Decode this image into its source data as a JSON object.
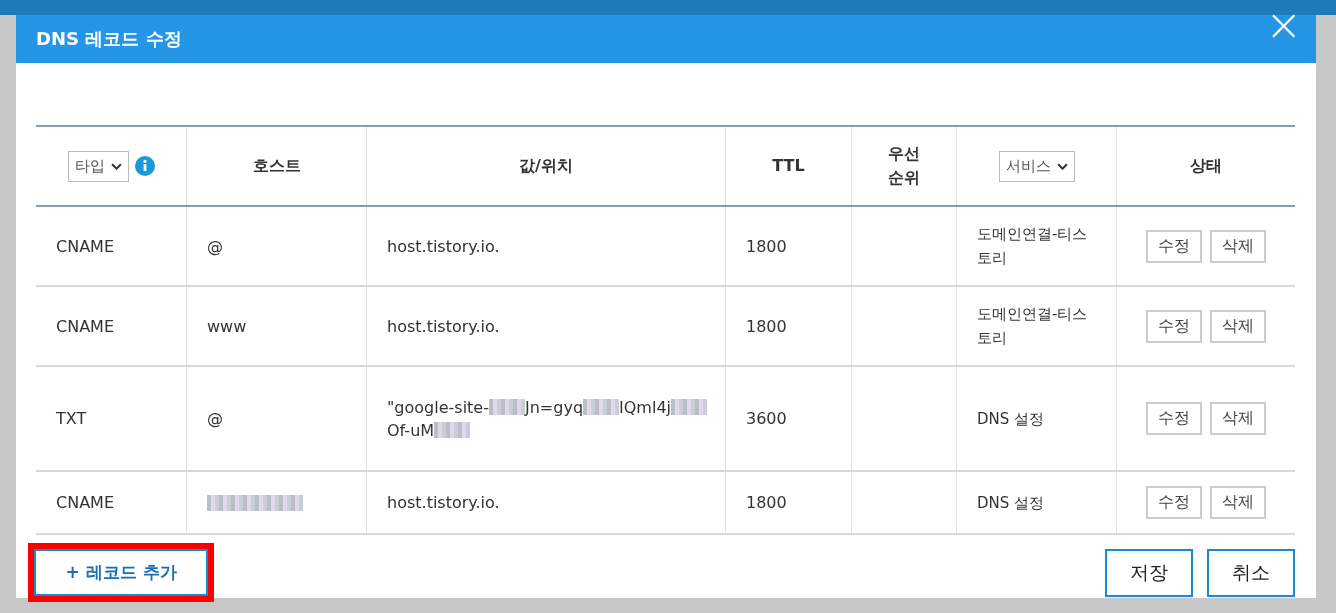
{
  "dialog": {
    "title": "DNS 레코드 수정",
    "close": "×"
  },
  "table": {
    "columns": [
      {
        "kind": "select",
        "label": "타입",
        "info": true
      },
      {
        "kind": "text",
        "label": "호스트"
      },
      {
        "kind": "text",
        "label": "값/위치"
      },
      {
        "kind": "text",
        "label": "TTL"
      },
      {
        "kind": "text",
        "label": "우선\n순위"
      },
      {
        "kind": "select",
        "label": "서비스",
        "info": false
      },
      {
        "kind": "text",
        "label": "상태"
      }
    ],
    "rows": [
      {
        "type": "CNAME",
        "host": [
          {
            "kind": "text",
            "text": "@"
          }
        ],
        "value": [
          {
            "kind": "text",
            "text": "host.tistory.io."
          }
        ],
        "ttl": "1800",
        "service": "도메인연결-티스토리",
        "actions": [
          "수정",
          "삭제"
        ]
      },
      {
        "type": "CNAME",
        "host": [
          {
            "kind": "text",
            "text": "www"
          }
        ],
        "value": [
          {
            "kind": "text",
            "text": "host.tistory.io."
          }
        ],
        "ttl": "1800",
        "service": "도메인연결-티스토리",
        "actions": [
          "수정",
          "삭제"
        ]
      },
      {
        "type": "TXT",
        "host": [
          {
            "kind": "text",
            "text": "@"
          }
        ],
        "value": [
          {
            "kind": "text",
            "text": "\"google-site-"
          },
          {
            "kind": "redacted"
          },
          {
            "kind": "text",
            "text": "Jn=gyq"
          },
          {
            "kind": "redacted"
          },
          {
            "kind": "text",
            "text": "IQml"
          },
          {
            "kind": "text",
            "text": "4j"
          },
          {
            "kind": "redacted"
          },
          {
            "kind": "text",
            "text": "Of-uM"
          },
          {
            "kind": "redacted"
          }
        ],
        "ttl": "3600",
        "service": "DNS 설정",
        "actions": [
          "수정",
          "삭제"
        ]
      },
      {
        "type": "CNAME",
        "host": [
          {
            "kind": "redacted"
          }
        ],
        "value": [
          {
            "kind": "text",
            "text": "host.tistory.io."
          }
        ],
        "ttl": "1800",
        "service": "DNS 설정",
        "actions": [
          "수정",
          "삭제"
        ]
      }
    ]
  },
  "add_button": {
    "label": "+ 레코드 추가",
    "highlighted": true
  },
  "buttons": [
    "저장",
    "취소"
  ]
}
